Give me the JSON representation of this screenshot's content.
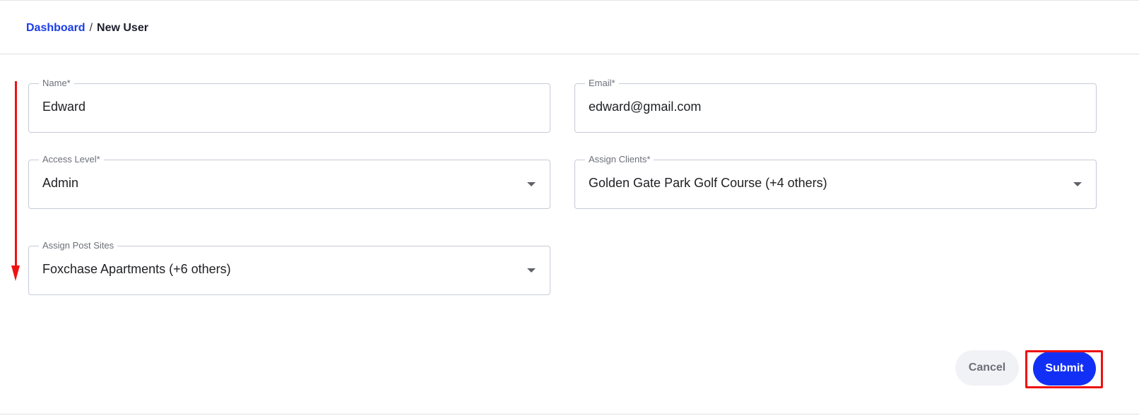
{
  "breadcrumb": {
    "parent": "Dashboard",
    "separator": "/",
    "current": "New User"
  },
  "form": {
    "name": {
      "label": "Name*",
      "value": "Edward"
    },
    "email": {
      "label": "Email*",
      "value": "edward@gmail.com"
    },
    "access_level": {
      "label": "Access Level*",
      "value": "Admin"
    },
    "assign_clients": {
      "label": "Assign Clients*",
      "value": "Golden Gate Park Golf Course (+4 others)"
    },
    "assign_post_sites": {
      "label": "Assign Post Sites",
      "value": "Foxchase Apartments (+6 others)"
    }
  },
  "actions": {
    "cancel_label": "Cancel",
    "submit_label": "Submit"
  },
  "colors": {
    "accent": "#1230f5",
    "link": "#1a3de8",
    "annotation": "#ee1111"
  }
}
